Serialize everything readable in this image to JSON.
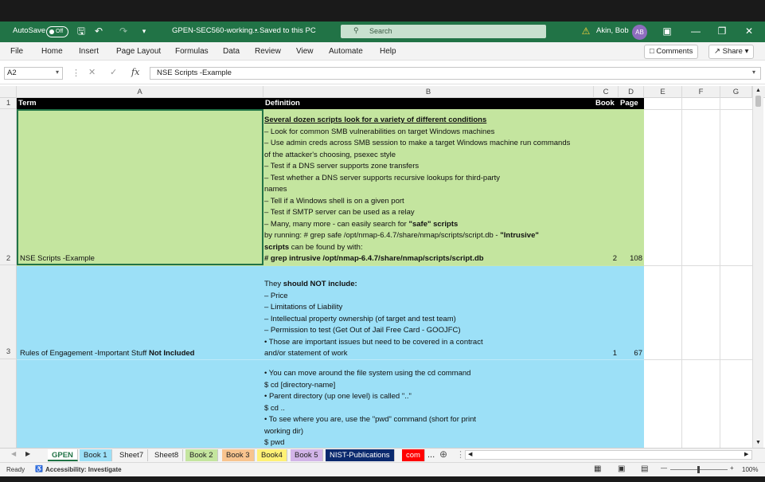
{
  "titlebar": {
    "autosave_label": "AutoSave",
    "autosave_state": "Off",
    "doc_title": "GPEN-SEC560-working...",
    "saved_status": "• Saved to this PC",
    "search_placeholder": "Search",
    "user_name": "Akin, Bob",
    "user_initials": "AB"
  },
  "menu": {
    "items": [
      "File",
      "Home",
      "Insert",
      "Page Layout",
      "Formulas",
      "Data",
      "Review",
      "View",
      "Automate",
      "Help"
    ],
    "comments_label": "Comments",
    "share_label": "Share"
  },
  "formula_bar": {
    "name_box": "A2",
    "formula": "NSE Scripts -Example"
  },
  "columns": [
    "A",
    "B",
    "C",
    "D",
    "E",
    "F",
    "G"
  ],
  "rows": [
    "1",
    "2",
    "3"
  ],
  "header_row": {
    "term": "Term",
    "definition": "Definition",
    "book": "Book",
    "page": "Page"
  },
  "row2": {
    "term": "NSE Scripts -Example",
    "lines": [
      "Several dozen scripts look for a variety of different conditions",
      "– Look for common SMB vulnerabilities on target Windows machines",
      "– Use admin creds across SMB session to make a target Windows machine run commands",
      "of the attacker's choosing, psexec style",
      "– Test if a DNS server supports zone transfers",
      "– Test whether a DNS server supports recursive lookups for third-party",
      "names",
      "– Tell if a Windows shell is on a given port",
      "– Test if SMTP server can be used as a relay"
    ],
    "line_many_a": "– Many, many more - can easily search for ",
    "line_many_b": "\"safe\" scripts",
    "line_run_a": "by running: # grep safe /opt/nmap-6.4.7/share/nmap/scripts/script.db - ",
    "line_run_b": "\"Intrusive\"",
    "line_found_a": "scripts",
    "line_found_b": " can be found by with:",
    "line_cmd": "# grep intrusive /opt/nmap-6.4.7/share/nmap/scripts/script.db",
    "book": "2",
    "page": "108"
  },
  "row3": {
    "term_a": "Rules of Engagement -Important Stuff ",
    "term_b": "Not Included",
    "line_they_a": "They ",
    "line_they_b": "should NOT include:",
    "lines": [
      "– Price",
      "– Limitations of Liability",
      "– Intellectual property ownership (of target and test team)",
      "– Permission to test (Get Out of Jail Free Card - GOOJFC)",
      "• Those are important issues but need to be covered in a contract",
      "and/or statement of work"
    ],
    "book": "1",
    "page": "67"
  },
  "row4": {
    "lines": [
      "• You can move around the file system using the cd command",
      "$ cd [directory-name]",
      "• Parent directory (up one level) is called \"..\"",
      "$ cd ..",
      "• To see where you are, use the \"pwd\" command (short for print",
      "working dir)",
      "$ pwd"
    ]
  },
  "sheet_tabs": [
    {
      "label": "GPEN",
      "color": "#ffffff"
    },
    {
      "label": "Book 1",
      "color": "#9ce0f7"
    },
    {
      "label": "Sheet7",
      "color": "#f3f3f3"
    },
    {
      "label": "Sheet8",
      "color": "#f3f3f3"
    },
    {
      "label": "Book 2",
      "color": "#c4e59f"
    },
    {
      "label": "Book 3",
      "color": "#f8c48f"
    },
    {
      "label": "Book4",
      "color": "#fff176"
    },
    {
      "label": "Book 5",
      "color": "#d2b4e8"
    },
    {
      "label": "NIST-Publications",
      "color": "#0b2a6e"
    },
    {
      "label": "com",
      "color": "#ff0000"
    }
  ],
  "tab_more": "...",
  "status": {
    "ready": "Ready",
    "accessibility": "Accessibility: Investigate",
    "zoom": "100%"
  },
  "colors": {
    "accent": "#217346",
    "row_green": "#c4e59f",
    "row_blue": "#9ce0f7"
  }
}
